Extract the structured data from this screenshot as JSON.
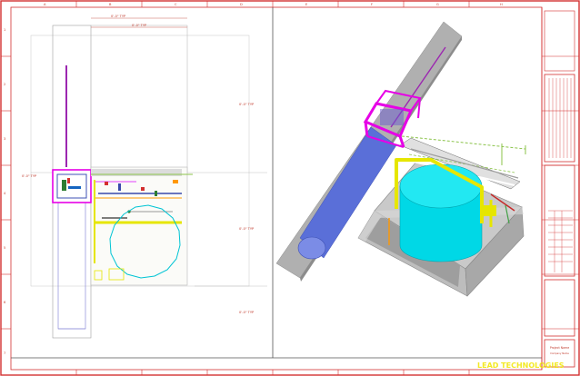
{
  "sheet": {
    "zone_letters": [
      "A",
      "B",
      "C",
      "D",
      "E",
      "F",
      "G",
      "H",
      "I",
      "J",
      "K"
    ],
    "zone_numbers": [
      "1",
      "2",
      "3",
      "4",
      "5",
      "6",
      "7"
    ]
  },
  "plan_view": {
    "dimensions": {
      "top_outer": "0'-0\" TYP",
      "top_inner": "0'-0\" TYP",
      "right_upper": "0'-0\" TYP",
      "left_mid": "0'-0\" TYP",
      "right_mid": "0'-0\" TYP",
      "right_lower": "0'-0\" TYP"
    }
  },
  "title_block": {
    "project_name": "Project Name",
    "company": "Company Name"
  },
  "watermark": "LEAD TECHNOLOGIES",
  "colors": {
    "border": "#d32f2f",
    "tank": "#00e5ee",
    "pipe": "#5a6fd8",
    "pipe_rack": "#e6e600",
    "frame": "#e600e6",
    "walkway": "#9e9e9e",
    "containment": "#bdbdbd",
    "watermark": "#f2e600"
  }
}
